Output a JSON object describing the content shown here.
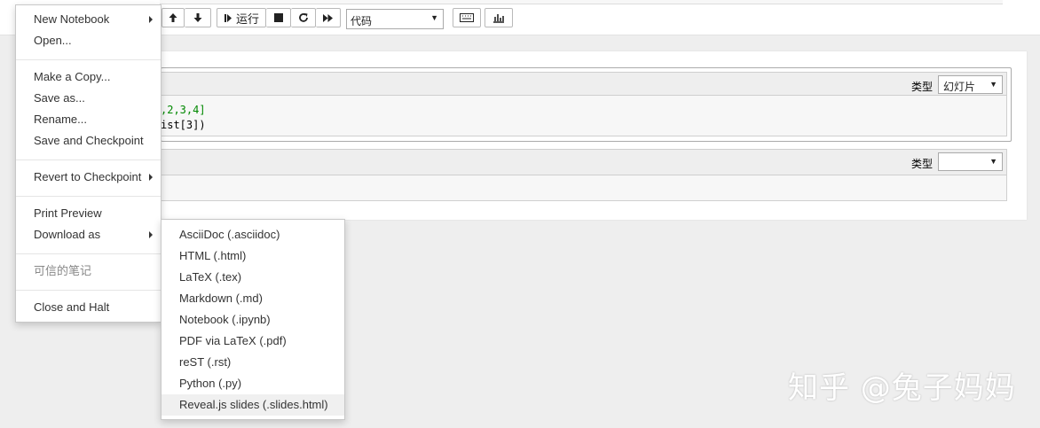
{
  "toolbar": {
    "run_label": "运行",
    "cell_type_value": "代码"
  },
  "cells": [
    {
      "type_label": "类型",
      "type_value": "幻灯片",
      "code_line1": ",2,3,4]",
      "code_line2": "ist[3])"
    },
    {
      "type_label": "类型",
      "type_value": ""
    }
  ],
  "file_menu": {
    "items": [
      "New Notebook",
      "Open...",
      "Make a Copy...",
      "Save as...",
      "Rename...",
      "Save and Checkpoint",
      "Revert to Checkpoint",
      "Print Preview",
      "Download as",
      "可信的笔记",
      "Close and Halt"
    ]
  },
  "download_menu": {
    "items": [
      "AsciiDoc (.asciidoc)",
      "HTML (.html)",
      "LaTeX (.tex)",
      "Markdown (.md)",
      "Notebook (.ipynb)",
      "PDF via LaTeX (.pdf)",
      "reST (.rst)",
      "Python (.py)",
      "Reveal.js slides (.slides.html)"
    ]
  },
  "watermark": "知乎 @兔子妈妈"
}
